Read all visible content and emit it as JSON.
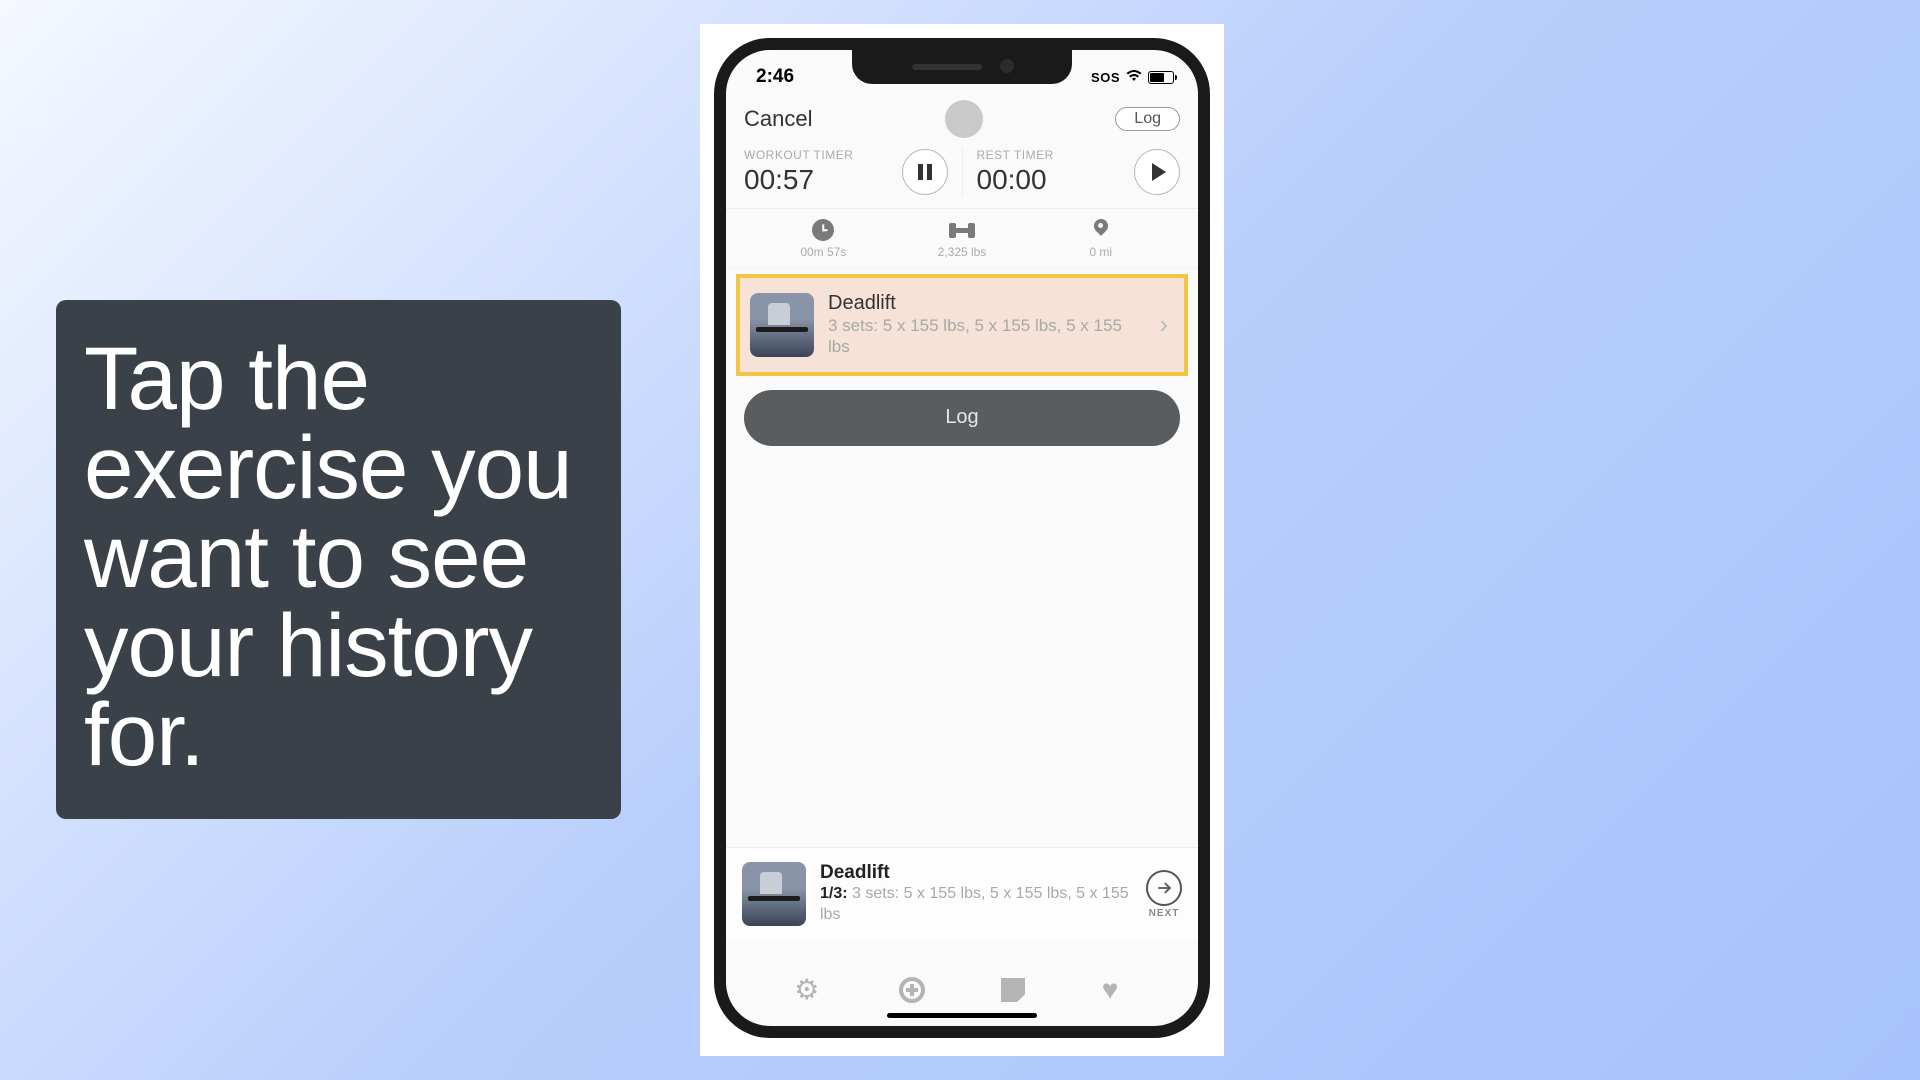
{
  "callout": {
    "text": "Tap the exercise you want to see your history for."
  },
  "statusbar": {
    "time": "2:46",
    "sos": "SOS"
  },
  "navbar": {
    "cancel": "Cancel",
    "log": "Log"
  },
  "timers": {
    "workout_label": "WORKOUT TIMER",
    "workout_value": "00:57",
    "rest_label": "REST TIMER",
    "rest_value": "00:00"
  },
  "stats": {
    "time": "00m 57s",
    "weight": "2,325 lbs",
    "distance": "0 mi"
  },
  "exercise": {
    "title": "Deadlift",
    "subtitle": "3 sets: 5 x 155 lbs, 5 x 155 lbs, 5 x 155 lbs"
  },
  "log_button": "Log",
  "bottom": {
    "title": "Deadlift",
    "progress": "1/3:",
    "detail": "3 sets: 5 x 155 lbs, 5 x 155 lbs, 5 x 155 lbs",
    "next": "NEXT"
  }
}
